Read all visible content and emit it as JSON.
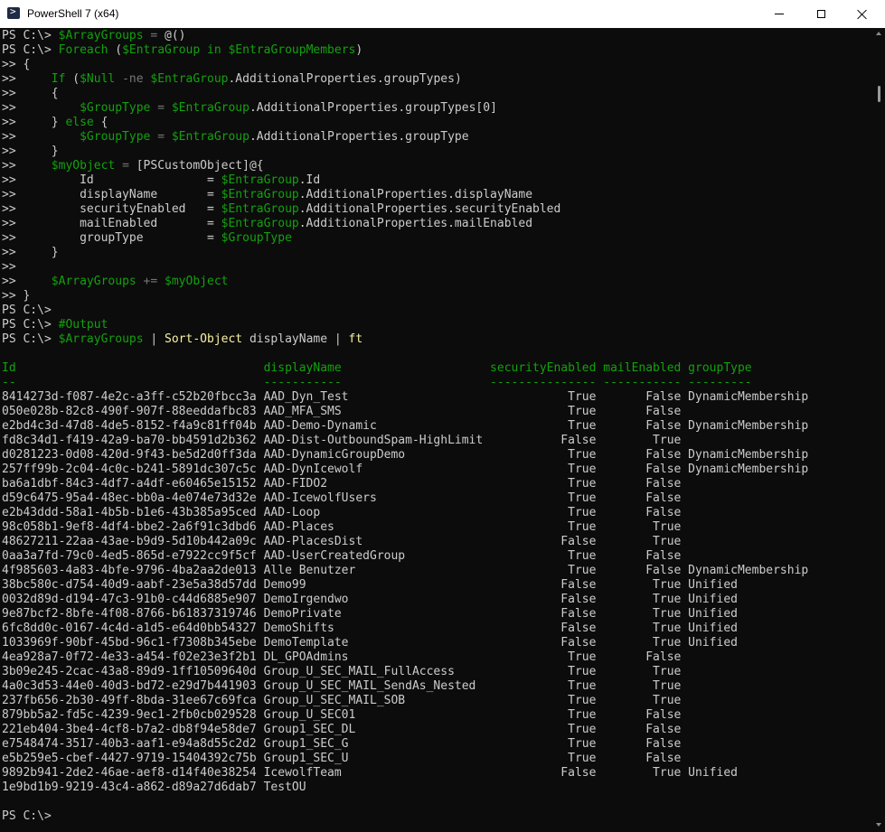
{
  "window": {
    "title": "PowerShell 7 (x64)",
    "icon": "powershell-icon",
    "controls": [
      "minimize-icon",
      "maximize-icon",
      "close-icon"
    ]
  },
  "colors": {
    "default": "#cccccc",
    "variable": "#13a10e",
    "keyword": "#13a10e",
    "command": "#f9f1a5",
    "string": "#3a96dd",
    "number": "#cccccc",
    "operator": "#767676",
    "comment": "#13a10e",
    "header": "#13a10e"
  },
  "console": {
    "lines": [
      [
        [
          "PS C:\\> ",
          "default"
        ],
        [
          "$ArrayGroups",
          "variable"
        ],
        [
          " = ",
          "operator"
        ],
        [
          "@()",
          "default"
        ]
      ],
      [
        [
          "PS C:\\> ",
          "default"
        ],
        [
          "Foreach",
          "keyword"
        ],
        [
          " (",
          "default"
        ],
        [
          "$EntraGroup",
          "variable"
        ],
        [
          " in ",
          "keyword"
        ],
        [
          "$EntraGroupMembers",
          "variable"
        ],
        [
          ")",
          "default"
        ]
      ],
      [
        [
          ">> {",
          "default"
        ]
      ],
      [
        [
          ">>     ",
          "default"
        ],
        [
          "If",
          "keyword"
        ],
        [
          " (",
          "default"
        ],
        [
          "$Null",
          "variable"
        ],
        [
          " -ne ",
          "operator"
        ],
        [
          "$EntraGroup",
          "variable"
        ],
        [
          ".AdditionalProperties.groupTypes)",
          "default"
        ]
      ],
      [
        [
          ">>     {",
          "default"
        ]
      ],
      [
        [
          ">>         ",
          "default"
        ],
        [
          "$GroupType",
          "variable"
        ],
        [
          " = ",
          "operator"
        ],
        [
          "$EntraGroup",
          "variable"
        ],
        [
          ".AdditionalProperties.groupTypes[",
          "default"
        ],
        [
          "0",
          "number"
        ],
        [
          "]",
          "default"
        ]
      ],
      [
        [
          ">>     } ",
          "default"
        ],
        [
          "else",
          "keyword"
        ],
        [
          " {",
          "default"
        ]
      ],
      [
        [
          ">>         ",
          "default"
        ],
        [
          "$GroupType",
          "variable"
        ],
        [
          " = ",
          "operator"
        ],
        [
          "$EntraGroup",
          "variable"
        ],
        [
          ".AdditionalProperties.groupType",
          "default"
        ]
      ],
      [
        [
          ">>     }",
          "default"
        ]
      ],
      [
        [
          ">>     ",
          "default"
        ],
        [
          "$myObject",
          "variable"
        ],
        [
          " = ",
          "operator"
        ],
        [
          "[PSCustomObject]@{",
          "default"
        ]
      ],
      [
        [
          ">>         Id                = ",
          "default"
        ],
        [
          "$EntraGroup",
          "variable"
        ],
        [
          ".Id",
          "default"
        ]
      ],
      [
        [
          ">>         displayName       = ",
          "default"
        ],
        [
          "$EntraGroup",
          "variable"
        ],
        [
          ".AdditionalProperties.displayName",
          "default"
        ]
      ],
      [
        [
          ">>         securityEnabled   = ",
          "default"
        ],
        [
          "$EntraGroup",
          "variable"
        ],
        [
          ".AdditionalProperties.securityEnabled",
          "default"
        ]
      ],
      [
        [
          ">>         mailEnabled       = ",
          "default"
        ],
        [
          "$EntraGroup",
          "variable"
        ],
        [
          ".AdditionalProperties.mailEnabled",
          "default"
        ]
      ],
      [
        [
          ">>         groupType         = ",
          "default"
        ],
        [
          "$GroupType",
          "variable"
        ]
      ],
      [
        [
          ">>     }",
          "default"
        ]
      ],
      [
        [
          ">>",
          "default"
        ]
      ],
      [
        [
          ">>     ",
          "default"
        ],
        [
          "$ArrayGroups",
          "variable"
        ],
        [
          " += ",
          "operator"
        ],
        [
          "$myObject",
          "variable"
        ]
      ],
      [
        [
          ">> }",
          "default"
        ]
      ],
      [
        [
          "PS C:\\>",
          "default"
        ]
      ],
      [
        [
          "PS C:\\> ",
          "default"
        ],
        [
          "#Output",
          "comment"
        ]
      ],
      [
        [
          "PS C:\\> ",
          "default"
        ],
        [
          "$ArrayGroups",
          "variable"
        ],
        [
          " | ",
          "default"
        ],
        [
          "Sort-Object",
          "command"
        ],
        [
          " displayName | ",
          "default"
        ],
        [
          "ft",
          "command"
        ]
      ],
      [
        [
          "",
          "default"
        ]
      ],
      [
        [
          "Id                                   displayName                     securityEnabled mailEnabled groupType",
          "header"
        ]
      ],
      [
        [
          "--                                   -----------                     --------------- ----------- ---------",
          "header"
        ]
      ],
      [
        [
          "8414273d-f087-4e2c-a3ff-c52b20fbcc3a AAD_Dyn_Test                               True       False DynamicMembership",
          "default"
        ]
      ],
      [
        [
          "050e028b-82c8-490f-907f-88eeddafbc83 AAD_MFA_SMS                                True       False",
          "default"
        ]
      ],
      [
        [
          "e2bd4c3d-47d8-4de5-8152-f4a9c81ff04b AAD-Demo-Dynamic                           True       False DynamicMembership",
          "default"
        ]
      ],
      [
        [
          "fd8c34d1-f419-42a9-ba70-bb4591d2b362 AAD-Dist-OutboundSpam-HighLimit           False        True",
          "default"
        ]
      ],
      [
        [
          "d0281223-0d08-420d-9f43-be5d2d0ff3da AAD-DynamicGroupDemo                       True       False DynamicMembership",
          "default"
        ]
      ],
      [
        [
          "257ff99b-2c04-4c0c-b241-5891dc307c5c AAD-DynIcewolf                             True       False DynamicMembership",
          "default"
        ]
      ],
      [
        [
          "ba6a1dbf-84c3-4df7-a4df-e60465e15152 AAD-FIDO2                                  True       False",
          "default"
        ]
      ],
      [
        [
          "d59c6475-95a4-48ec-bb0a-4e074e73d32e AAD-IcewolfUsers                           True       False",
          "default"
        ]
      ],
      [
        [
          "e2b43ddd-58a1-4b5b-b1e6-43b385a95ced AAD-Loop                                   True       False",
          "default"
        ]
      ],
      [
        [
          "98c058b1-9ef8-4df4-bbe2-2a6f91c3dbd6 AAD-Places                                 True        True",
          "default"
        ]
      ],
      [
        [
          "48627211-22aa-43ae-b9d9-5d10b442a09c AAD-PlacesDist                            False        True",
          "default"
        ]
      ],
      [
        [
          "0aa3a7fd-79c0-4ed5-865d-e7922cc9f5cf AAD-UserCreatedGroup                       True       False",
          "default"
        ]
      ],
      [
        [
          "4f985603-4a83-4bfe-9796-4ba2aa2de013 Alle Benutzer                              True       False DynamicMembership",
          "default"
        ]
      ],
      [
        [
          "38bc580c-d754-40d9-aabf-23e5a38d57dd Demo99                                    False        True Unified",
          "default"
        ]
      ],
      [
        [
          "0032d89d-d194-47c3-91b0-c44d6885e907 DemoIrgendwo                              False        True Unified",
          "default"
        ]
      ],
      [
        [
          "9e87bcf2-8bfe-4f08-8766-b61837319746 DemoPrivate                               False        True Unified",
          "default"
        ]
      ],
      [
        [
          "6fc8dd0c-0167-4c4d-a1d5-e64d0bb54327 DemoShifts                                False        True Unified",
          "default"
        ]
      ],
      [
        [
          "1033969f-90bf-45bd-96c1-f7308b345ebe DemoTemplate                              False        True Unified",
          "default"
        ]
      ],
      [
        [
          "4ea928a7-0f72-4e33-a454-f02e23e3f2b1 DL_GPOAdmins                               True       False",
          "default"
        ]
      ],
      [
        [
          "3b09e245-2cac-43a8-89d9-1ff10509640d Group_U_SEC_MAIL_FullAccess                True        True",
          "default"
        ]
      ],
      [
        [
          "4a0c3d53-44e0-40d3-bd72-e29d7b441903 Group_U_SEC_MAIL_SendAs_Nested             True        True",
          "default"
        ]
      ],
      [
        [
          "237fb656-2b30-49ff-8bda-31ee67c69fca Group_U_SEC_MAIL_SOB                       True        True",
          "default"
        ]
      ],
      [
        [
          "879bb5a2-fd5c-4239-9ec1-2fb0cb029528 Group_U_SEC01                              True       False",
          "default"
        ]
      ],
      [
        [
          "221eb404-3be4-4cf8-b7a2-db8f94e58de7 Group1_SEC_DL                              True       False",
          "default"
        ]
      ],
      [
        [
          "e7548474-3517-40b3-aaf1-e94a8d55c2d2 Group1_SEC_G                               True       False",
          "default"
        ]
      ],
      [
        [
          "e5b259e5-cbef-4427-9719-15404392c75b Group1_SEC_U                               True       False",
          "default"
        ]
      ],
      [
        [
          "9892b941-2de2-46ae-aef8-d14f40e38254 IcewolfTeam                               False        True Unified",
          "default"
        ]
      ],
      [
        [
          "1e9bd1b9-9219-43c4-a862-d89a27d6dab7 TestOU",
          "default"
        ]
      ],
      [
        [
          "",
          "default"
        ]
      ],
      [
        [
          "PS C:\\>",
          "default"
        ]
      ]
    ]
  }
}
